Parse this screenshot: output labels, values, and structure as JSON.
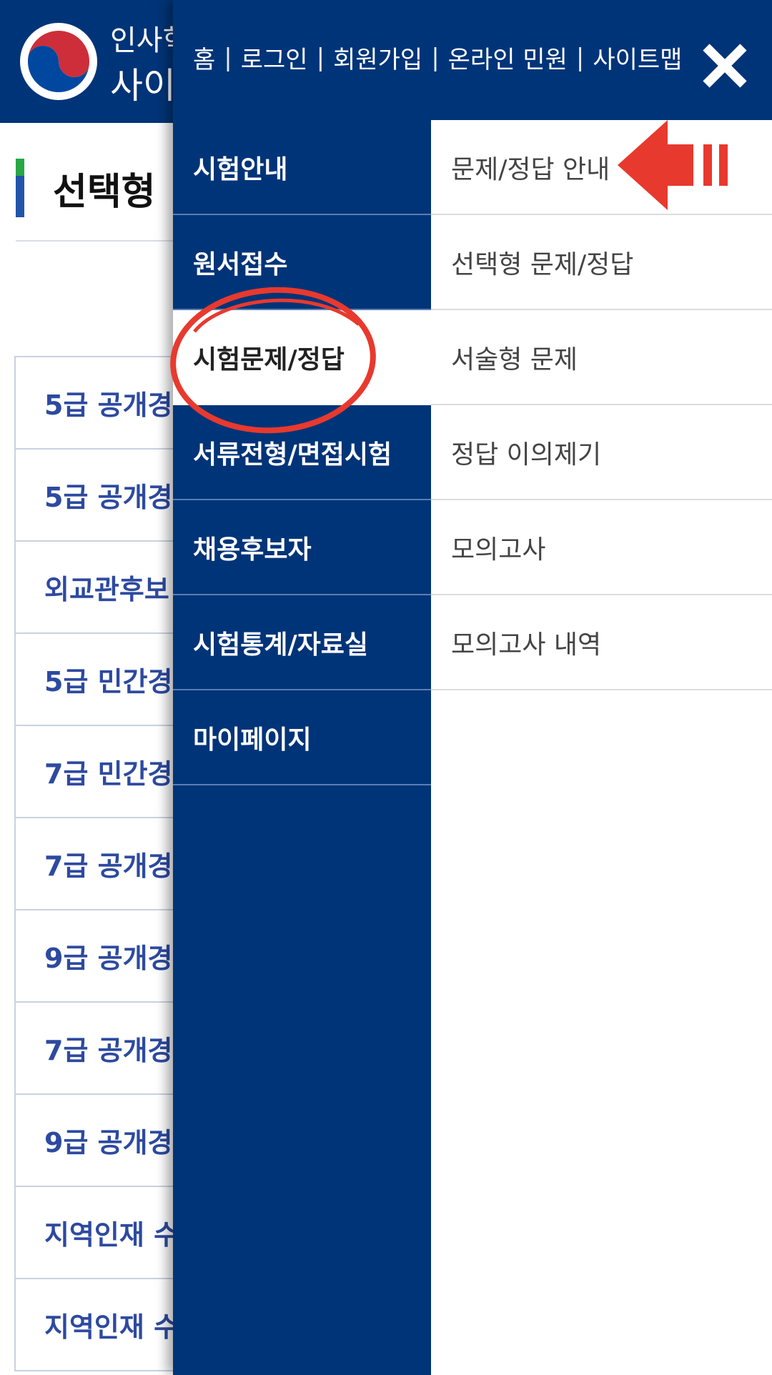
{
  "background_page": {
    "site_name_line1": "인사혁",
    "site_name_line2": "사이",
    "page_title": "선택형",
    "list_items": [
      "5급 공개경",
      "5급 공개경",
      "외교관후보",
      "5급 민간경",
      "7급 민간경",
      "7급 공개경",
      "9급 공개경",
      "7급 공개경",
      "9급 공개경",
      "지역인재 수",
      "지역인재 수"
    ]
  },
  "drawer": {
    "util_nav": [
      "홈",
      "로그인",
      "회원가입",
      "온라인 민원",
      "사이트맵"
    ],
    "menu": [
      {
        "label": "시험안내",
        "active": false
      },
      {
        "label": "원서접수",
        "active": false
      },
      {
        "label": "시험문제/정답",
        "active": true
      },
      {
        "label": "서류전형/면접시험",
        "active": false
      },
      {
        "label": "채용후보자",
        "active": false
      },
      {
        "label": "시험통계/자료실",
        "active": false
      },
      {
        "label": "마이페이지",
        "active": false
      }
    ],
    "submenu": [
      "문제/정답 안내",
      "선택형 문제/정답",
      "서술형 문제",
      "정답 이의제기",
      "모의고사",
      "모의고사 내역"
    ]
  },
  "colors": {
    "primary_navy": "#003478",
    "annotation_red": "#e8392e",
    "list_text_blue": "#2d4aa0"
  },
  "icons": {
    "close": "close-icon",
    "emblem": "government-emblem-icon",
    "annotation_arrow": "left-arrow-annotation-icon"
  }
}
